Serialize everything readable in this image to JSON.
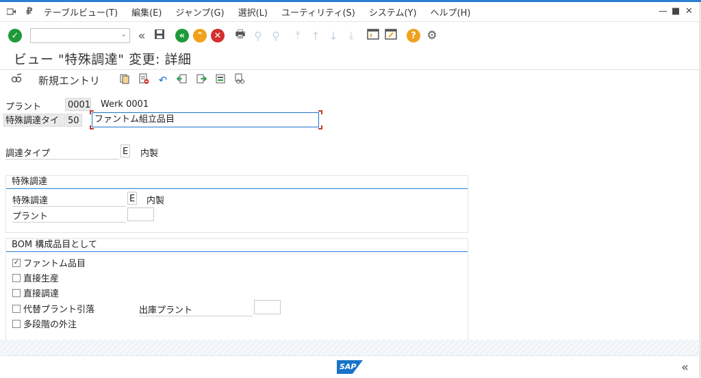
{
  "menu": {
    "items": [
      "テーブルビュー(T)",
      "編集(E)",
      "ジャンプ(G)",
      "選択(L)",
      "ユーティリティ(S)",
      "システム(Y)",
      "ヘルプ(H)"
    ]
  },
  "window_controls": {
    "minimize": "—",
    "maximize": "■",
    "close": "✕"
  },
  "toolbar": {
    "command_field_value": "",
    "icons": [
      "enter-icon",
      "back-double-icon",
      "save-icon",
      "back-icon",
      "exit-icon",
      "cancel-icon",
      "print-icon",
      "find-icon",
      "find-next-icon",
      "first-page-icon",
      "prev-page-icon",
      "next-page-icon",
      "last-page-icon",
      "create-session-icon",
      "shortcut-icon",
      "help-icon",
      "settings-icon"
    ]
  },
  "title": "ビュー \"特殊調達\" 変更: 詳細",
  "app_toolbar": {
    "new_entries_label": "新規エントリ"
  },
  "header": {
    "plant_label": "プラント",
    "plant_value": "0001",
    "plant_name": "Werk 0001",
    "spec_proc_type_label": "特殊調達タイプ",
    "spec_proc_type_value": "50",
    "spec_proc_type_desc": "ファントム組立品目"
  },
  "procurement": {
    "label": "調達タイプ",
    "value": "E",
    "desc": "内製"
  },
  "group_special": {
    "title": "特殊調達",
    "special_label": "特殊調達",
    "special_value": "E",
    "special_desc": "内製",
    "plant_label": "プラント",
    "plant_value": ""
  },
  "group_bom": {
    "title": "BOM 構成品目として",
    "phantom_label": "ファントム品目",
    "phantom_checked": true,
    "direct_prod_label": "直接生産",
    "direct_proc_label": "直接調達",
    "withdrawal_label": "代替プラント引落",
    "issue_plant_label": "出庫プラント",
    "issue_plant_value": "",
    "multilevel_label": "多段階の外注"
  },
  "status": {
    "logo": "SAP"
  },
  "colors": {
    "accent": "#2b7fd4",
    "green": "#1e9a3a",
    "orange": "#f0a21c",
    "red": "#d32f2f"
  }
}
